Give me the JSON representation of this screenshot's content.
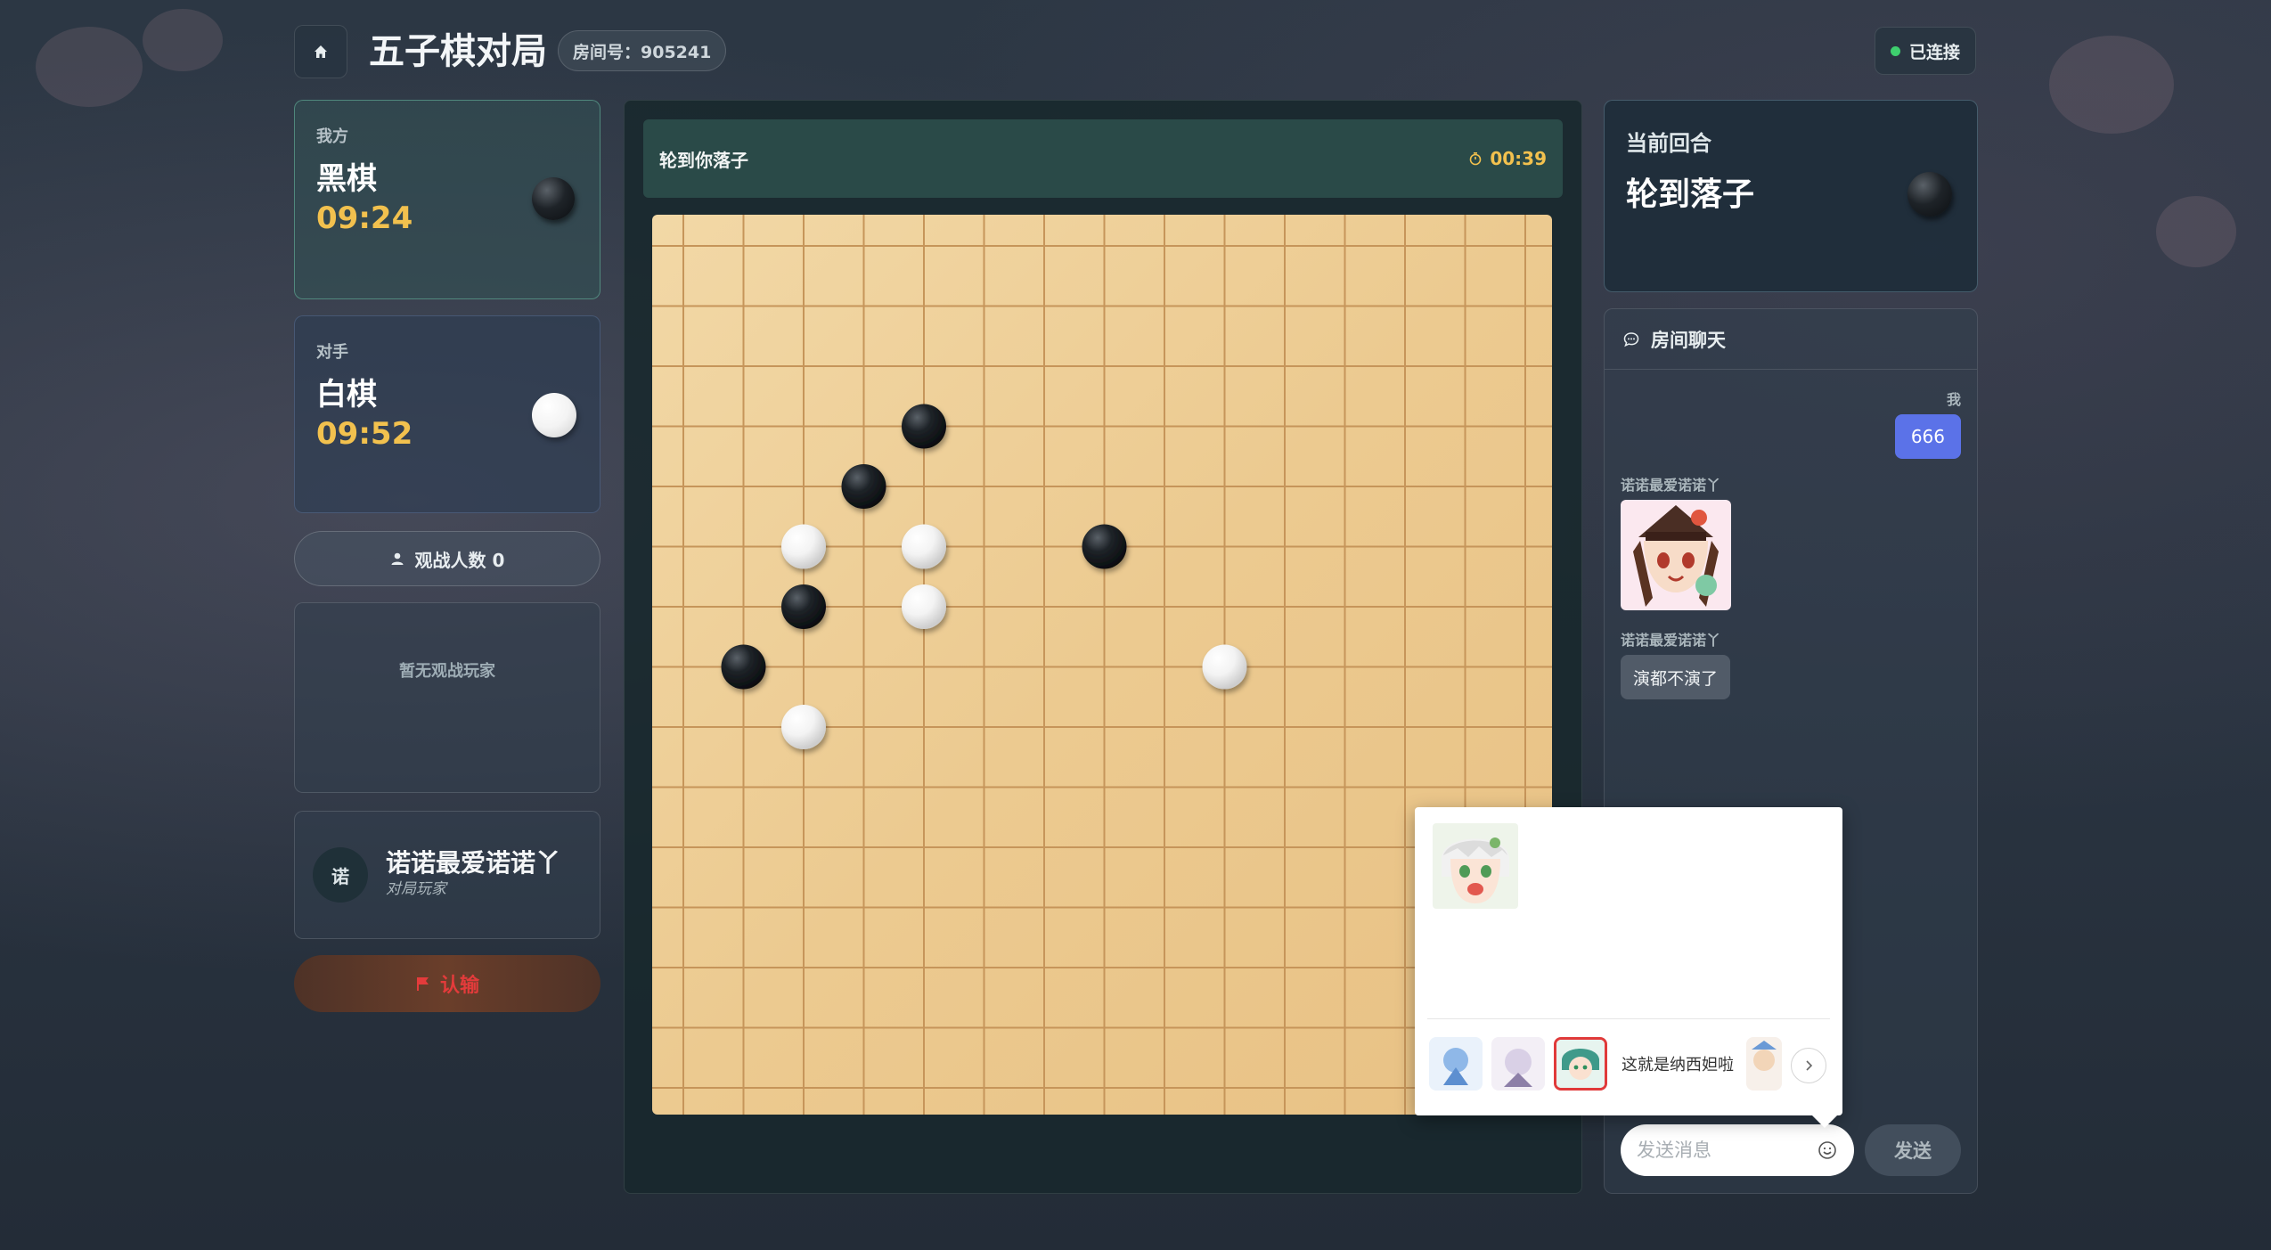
{
  "header": {
    "title": "五子棋对局",
    "room_label": "房间号：905241",
    "connection_status": "已连接"
  },
  "players": {
    "me": {
      "side_label": "我方",
      "color": "黑棋",
      "time": "09:24",
      "stone": "black"
    },
    "opponent": {
      "side_label": "对手",
      "color": "白棋",
      "time": "09:52",
      "stone": "white"
    }
  },
  "spectators": {
    "button_label": "观战人数 0",
    "empty_text": "暂无观战玩家"
  },
  "user": {
    "avatar_char": "诺",
    "name": "诺诺最爱诺诺丫",
    "role": "对局玩家"
  },
  "resign_label": "认输",
  "turn_bar": {
    "text": "轮到你落子",
    "timer": "00:39"
  },
  "board": {
    "size": 15,
    "stones": [
      {
        "col": 4,
        "row": 3,
        "color": "black"
      },
      {
        "col": 3,
        "row": 4,
        "color": "black"
      },
      {
        "col": 2,
        "row": 5,
        "color": "white"
      },
      {
        "col": 4,
        "row": 5,
        "color": "white"
      },
      {
        "col": 7,
        "row": 5,
        "color": "black"
      },
      {
        "col": 2,
        "row": 6,
        "color": "black"
      },
      {
        "col": 4,
        "row": 6,
        "color": "white"
      },
      {
        "col": 1,
        "row": 7,
        "color": "black"
      },
      {
        "col": 9,
        "row": 7,
        "color": "white"
      },
      {
        "col": 2,
        "row": 8,
        "color": "white"
      }
    ]
  },
  "current_turn": {
    "heading": "当前回合",
    "value": "轮到落子",
    "stone": "black"
  },
  "chat": {
    "title": "房间聊天",
    "messages": [
      {
        "sender": "我",
        "type": "text",
        "text": "666"
      },
      {
        "sender": "诺诺最爱诺诺丫",
        "type": "sticker"
      },
      {
        "sender": "诺诺最爱诺诺丫",
        "type": "text",
        "text": "演都不演了"
      }
    ],
    "input_placeholder": "发送消息",
    "send_label": "发送"
  },
  "emoji_popup": {
    "active_pack_label": "这就是纳西妲啦",
    "tab_count": 4
  },
  "colors": {
    "accent_gold": "#f2c14e",
    "connected_green": "#3ecf6e",
    "my_bubble": "#5b72e8",
    "resign_red": "#e33b3b"
  }
}
